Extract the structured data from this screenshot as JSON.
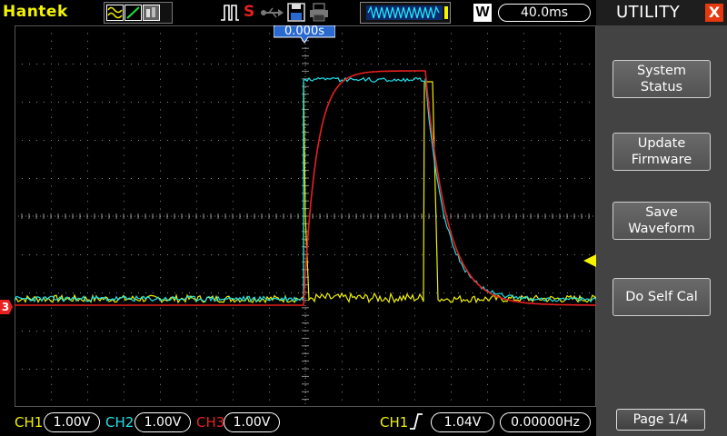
{
  "brand": "Hantek",
  "top_bar": {
    "trigger_position_label": "0.000s",
    "w_label": "W",
    "timebase": "40.0ms",
    "run_icon": "run-pulse-icon",
    "save_icon": "floppy-icon",
    "print_icon": "printer-icon",
    "usb_icon": "usb-icon",
    "s_label": "S"
  },
  "panel": {
    "title": "UTILITY",
    "close_label": "X",
    "buttons": [
      {
        "line1": "System",
        "line2": "Status"
      },
      {
        "line1": "Update",
        "line2": "Firmware"
      },
      {
        "line1": "Save",
        "line2": "Waveform"
      },
      {
        "line1": "Do Self Cal",
        "line2": ""
      }
    ],
    "page_label": "Page 1/4"
  },
  "channels": {
    "ch1": {
      "label": "CH1",
      "scale": "1.00V",
      "color": "#f0f000"
    },
    "ch2": {
      "label": "CH2",
      "scale": "1.00V",
      "color": "#20e0e8"
    },
    "ch3": {
      "label": "CH3",
      "scale": "1.00V",
      "color": "#e82020"
    },
    "ch3_marker": "3"
  },
  "trigger": {
    "source": "CH1",
    "edge_icon": "rising-edge-icon",
    "level": "1.04V",
    "frequency": "0.00000Hz"
  },
  "colors": {
    "grid": "#8a8a8a",
    "panel_bg": "#434343",
    "trigger_marker": "#f4f400",
    "accent_blue": "#2a6ad0"
  }
}
